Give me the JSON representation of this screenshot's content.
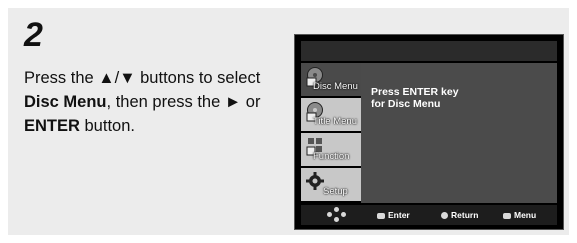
{
  "step": {
    "number": "2"
  },
  "instruction": {
    "t1": "Press the ",
    "arrows": "▲/▼",
    "t2": " buttons to select ",
    "b1": "Disc Menu",
    "t3": ", then press the ",
    "right": "►",
    "t4": " or ",
    "b2": "ENTER",
    "t5": " button."
  },
  "screen": {
    "menu": [
      {
        "label": "Disc Menu",
        "icon": "disc-menu-icon",
        "active": true
      },
      {
        "label": "Title Menu",
        "icon": "title-menu-icon",
        "active": false
      },
      {
        "label": "Function",
        "icon": "function-icon",
        "active": false
      },
      {
        "label": "Setup",
        "icon": "setup-icon",
        "active": false
      }
    ],
    "message": {
      "line1": "Press ENTER key",
      "line2": "for Disc Menu"
    },
    "bottom": {
      "enter": "Enter",
      "return": "Return",
      "menu": "Menu"
    }
  },
  "colors": {
    "panel": "#ececec",
    "active_menu": "#4a4a4a",
    "menu_bg": "#c8c8c8",
    "content": "#4b4b4b"
  }
}
